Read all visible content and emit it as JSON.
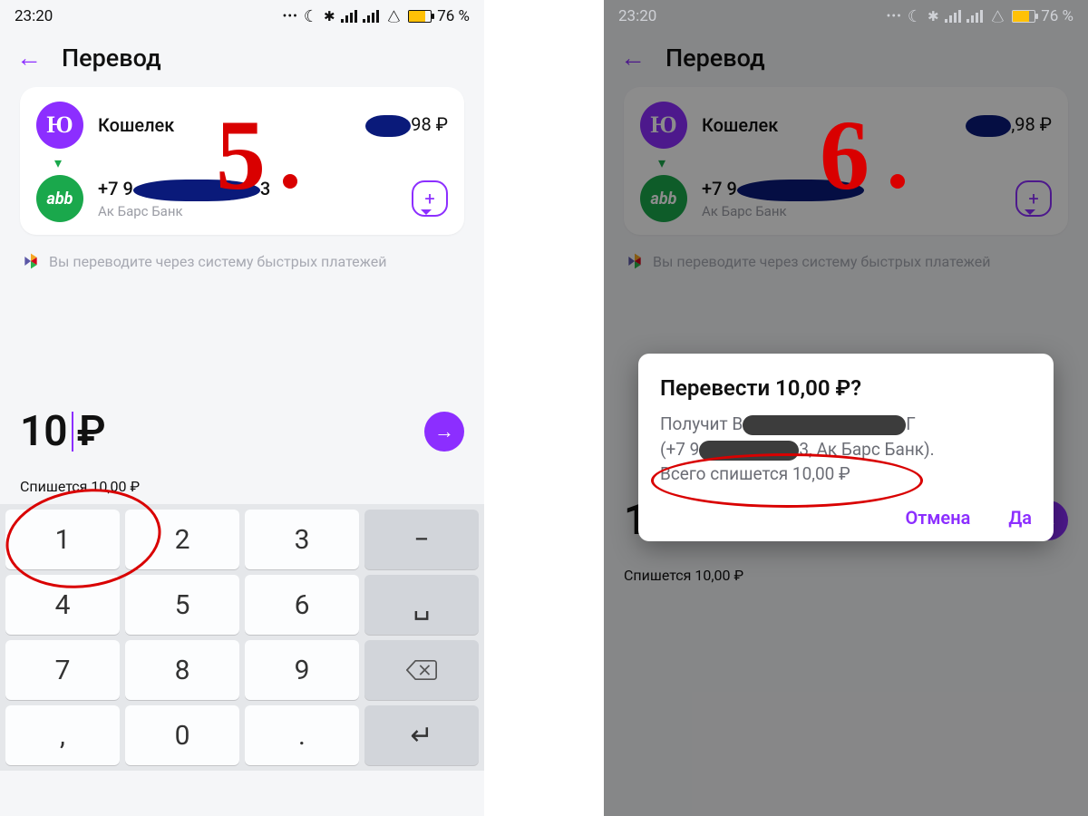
{
  "status": {
    "time": "23:20",
    "battery": "76 %"
  },
  "header": {
    "title": "Перевод"
  },
  "wallet": {
    "label": "Кошелек",
    "balance_suffix": "98 ₽",
    "balance_suffix_right": ",98 ₽"
  },
  "recipient": {
    "phone_prefix": "+7 9",
    "phone_suffix": "3",
    "bank": "Ак Барс Банк"
  },
  "sbp": {
    "text": "Вы переводите через систему быстрых платежей"
  },
  "amount": {
    "value": "10",
    "currency": "₽",
    "charge_left": "Спишется 10,00 ₽",
    "charge_right": "Спишется 10,00 ₽"
  },
  "keypad": {
    "k1": "1",
    "k2": "2",
    "k3": "3",
    "minus": "−",
    "k4": "4",
    "k5": "5",
    "k6": "6",
    "space": "␣",
    "k7": "7",
    "k8": "8",
    "k9": "9",
    "comma": ",",
    "k0": "0",
    "dot": ".",
    "enter": "↵"
  },
  "dialog": {
    "title": "Перевести 10,00 ₽?",
    "line1_prefix": "Получит В",
    "line1_suffix": "Г",
    "line2_prefix": "(+7 9",
    "line2_mid": "3, Ак Барс Банк).",
    "line3": "Всего спишется 10,00 ₽",
    "cancel": "Отмена",
    "ok": "Да"
  },
  "steps": {
    "left": "5",
    "right": "6"
  }
}
